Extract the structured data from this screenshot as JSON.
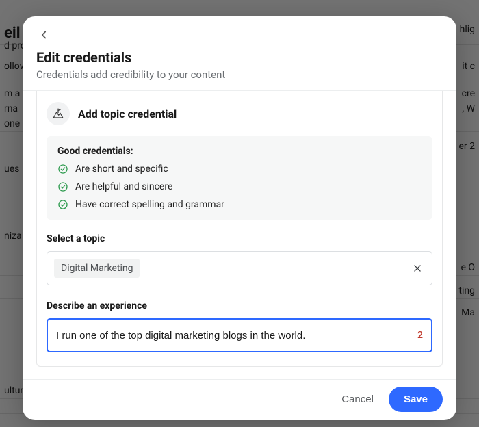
{
  "modal": {
    "title": "Edit credentials",
    "subtitle": "Credentials add credibility to your content",
    "add_label": "Add topic credential",
    "tips_title": "Good credentials:",
    "tips": [
      "Are short and specific",
      "Are helpful and sincere",
      "Have correct spelling and grammar"
    ],
    "select_label": "Select a topic",
    "selected_topic": "Digital Marketing",
    "experience_label": "Describe an experience",
    "experience_value": "I run one of the top digital marketing blogs in the world.",
    "char_remaining": "2",
    "cancel_label": "Cancel",
    "save_label": "Save"
  },
  "background": {
    "left_fragments": [
      "eil",
      "d pro",
      "ollow",
      "m a",
      "rna",
      "one",
      "ues",
      "niza",
      "ultur"
    ],
    "right_fragments": [
      "hlig",
      "it c",
      "cre",
      ", W",
      "er 2",
      "e O",
      "ting",
      "Ma"
    ]
  }
}
